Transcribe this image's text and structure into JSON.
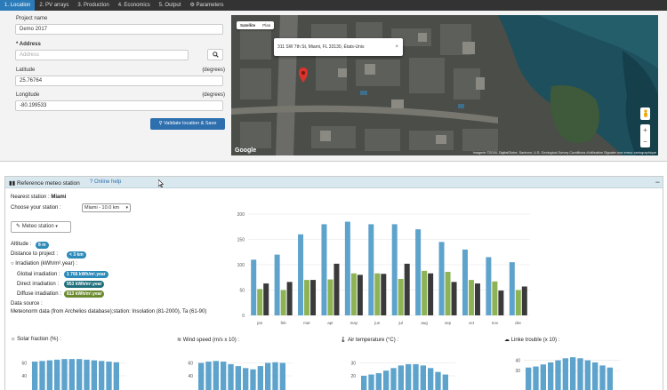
{
  "nav": {
    "tabs": [
      {
        "label": "1. Location",
        "active": true
      },
      {
        "label": "2. PV arrays"
      },
      {
        "label": "3. Production"
      },
      {
        "label": "4. Economics"
      },
      {
        "label": "5. Output"
      },
      {
        "label": "Parameters",
        "icon": "gears-icon"
      }
    ]
  },
  "form": {
    "project_name_label": "Project name",
    "project_name_value": "Demo 2017",
    "address_label": "Address",
    "address_placeholder": "Address",
    "latitude_label": "Latitude",
    "latitude_unit": "(degrees)",
    "latitude_value": "25.76764",
    "longitude_label": "Longitude",
    "longitude_unit": "(degrees)",
    "longitude_value": "-80.199533",
    "validate_label": "Validate location & Save"
  },
  "map": {
    "type_satellite": "Satellite",
    "type_plan": "Plan",
    "address_popup": "311 SW 7th St, Miami, FL 33130, États-Unis",
    "google_logo": "Google",
    "attribution": "Imagerie ©2016, DigitalGlobe, Sanborn, U.S. Geological Survey   Conditions d'utilisation   Signaler une erreur cartographique",
    "zoom_in": "+",
    "zoom_out": "−"
  },
  "meteo": {
    "title": "Reference meteo station",
    "help_label": "Online help",
    "collapse_label": "−",
    "nearest_label": "Nearest station :",
    "nearest_value": "Miami",
    "choose_label": "Choose your station :",
    "station_selected": "Miami - 10.0 km",
    "meteo_button_label": "Meteo station",
    "altitude_label": "Altitude :",
    "altitude_value": "8 m",
    "distance_label": "Distance to project :",
    "distance_value": "< 3 km",
    "irradiation_label": "Irradiation (kWh/m².year) :",
    "global_label": "Global irradiation :",
    "global_value": "1 766 kWh/m².year",
    "direct_label": "Direct irradiation :",
    "direct_value": "953 kWh/m².year",
    "diffuse_label": "Diffuse irradiation :",
    "diffuse_value": "813 kWh/m².year",
    "source_label": "Data source :",
    "source_value": "Meteonorm data (from Archelios database);station: Insolation (81-2000), Ta (61-90)",
    "colors": {
      "global": "#2e8ab8",
      "direct": "#22707d",
      "diffuse": "#6b8a2e",
      "blue_bar": "#5ea3cc",
      "green_bar": "#8db355",
      "dark_bar": "#3a3a3a"
    }
  },
  "chart_data": [
    {
      "type": "bar",
      "categories": [
        "jan",
        "feb",
        "mar",
        "apr",
        "may",
        "jun",
        "jul",
        "aug",
        "sep",
        "oct",
        "nov",
        "dec"
      ],
      "series": [
        {
          "values": [
            110,
            120,
            160,
            180,
            185,
            180,
            180,
            170,
            145,
            130,
            115,
            105
          ]
        },
        {
          "values": [
            52,
            50,
            70,
            71,
            83,
            83,
            72,
            88,
            86,
            70,
            67,
            50
          ]
        },
        {
          "values": [
            63,
            66,
            70,
            102,
            80,
            82,
            102,
            83,
            66,
            63,
            49,
            57
          ]
        }
      ],
      "ylim": [
        0,
        200
      ],
      "yticks": [
        0,
        50,
        100,
        150,
        200
      ]
    },
    {
      "type": "bar",
      "title": "Solar fraction (%) :",
      "icon": "sun-icon",
      "yticks": [
        60,
        40
      ],
      "ylim": [
        0,
        80
      ],
      "values": [
        62,
        63,
        64,
        65,
        66,
        66,
        66,
        65,
        64,
        63,
        62,
        61
      ]
    },
    {
      "type": "bar",
      "title": "Wind speed (m/s x 10) :",
      "icon": "wind-icon",
      "yticks": [
        60,
        40
      ],
      "ylim": [
        0,
        80
      ],
      "values": [
        60,
        62,
        63,
        62,
        58,
        55,
        52,
        50,
        55,
        60,
        61,
        60
      ]
    },
    {
      "type": "bar",
      "title": "Air temperature (°C) :",
      "icon": "thermometer-icon",
      "yticks": [
        30,
        20
      ],
      "ylim": [
        0,
        40
      ],
      "values": [
        20,
        21,
        22,
        24,
        26,
        28,
        29,
        29,
        28,
        26,
        23,
        21
      ]
    },
    {
      "type": "bar",
      "title": "Linke trouble (x 10) :",
      "icon": "cloud-icon",
      "yticks": [
        40,
        30
      ],
      "ylim": [
        0,
        50
      ],
      "values": [
        33,
        34,
        36,
        38,
        40,
        42,
        43,
        42,
        40,
        38,
        35,
        33
      ]
    }
  ]
}
